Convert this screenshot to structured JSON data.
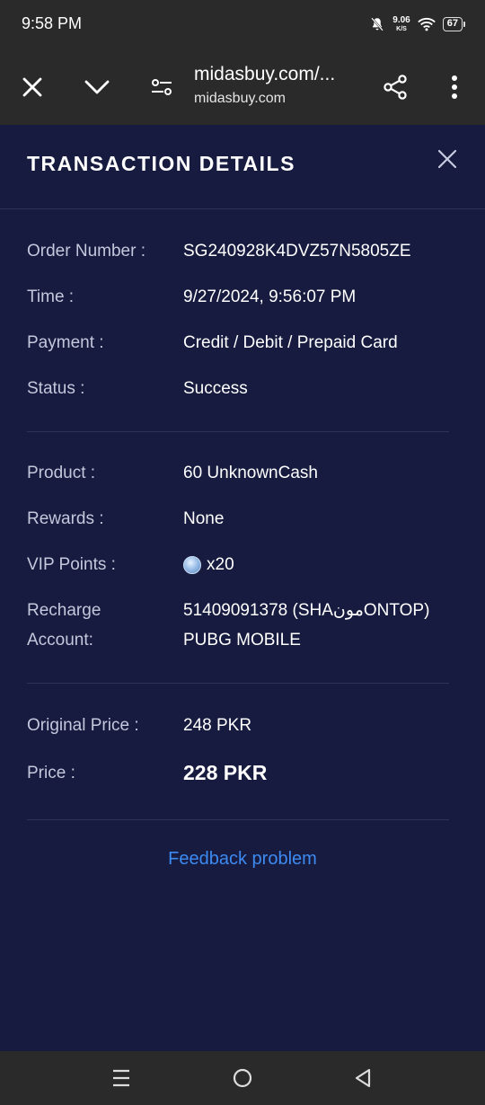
{
  "status_bar": {
    "time": "9:58 PM",
    "net_speed_value": "9.06",
    "net_speed_unit": "K/S",
    "battery": "67"
  },
  "browser": {
    "url_title": "midasbuy.com/...",
    "url_domain": "midasbuy.com"
  },
  "panel": {
    "title": "TRANSACTION DETAILS",
    "order_label": "Order Number :",
    "order_value": "SG240928K4DVZ57N5805ZE",
    "time_label": "Time :",
    "time_value": "9/27/2024, 9:56:07 PM",
    "payment_label": "Payment :",
    "payment_value": "Credit / Debit / Prepaid Card",
    "status_label": "Status :",
    "status_value": "Success",
    "product_label": "Product :",
    "product_value": "60 UnknownCash",
    "rewards_label": "Rewards :",
    "rewards_value": "None",
    "vip_label": "VIP Points :",
    "vip_value": "x20",
    "recharge_label_1": "Recharge",
    "recharge_label_2": "Account:",
    "recharge_value_1": "51409091378 (SHAمونONTOP)",
    "recharge_value_2": "PUBG MOBILE",
    "original_price_label": "Original Price :",
    "original_price_value": "248 PKR",
    "price_label": "Price :",
    "price_value": "228 PKR",
    "feedback": "Feedback problem"
  },
  "colors": {
    "panel_bg": "#161b3f",
    "chrome_bg": "#2a2a2a",
    "link": "#3d8bf2",
    "label": "#c4c8dc"
  }
}
